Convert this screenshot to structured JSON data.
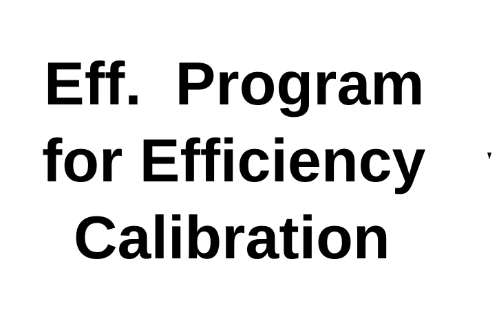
{
  "title": {
    "lines": [
      "Eff.  Program",
      "for Efficiency",
      "Calibration"
    ]
  },
  "colors": {
    "background": "#ffffff",
    "text": "#000000"
  }
}
